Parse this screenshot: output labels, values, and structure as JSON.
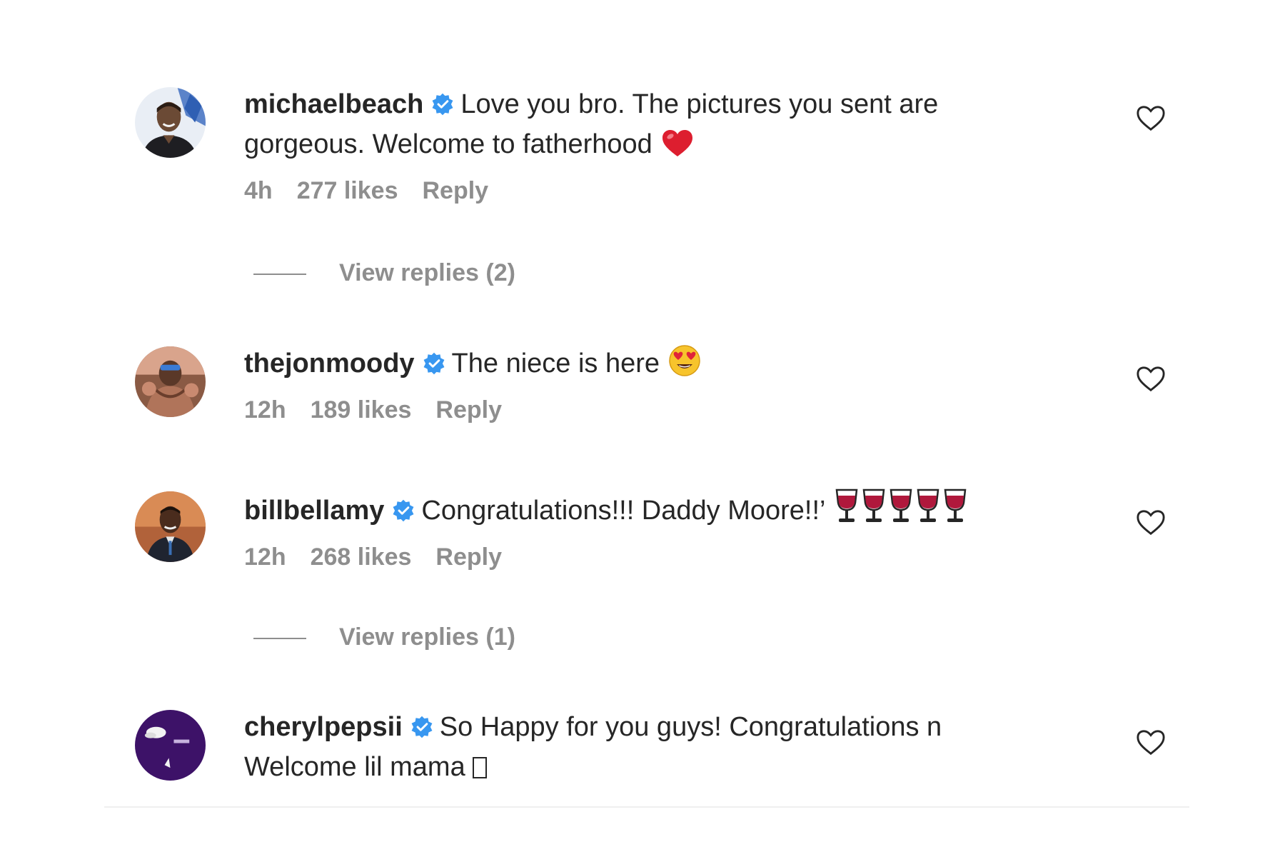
{
  "colors": {
    "username": "#262626",
    "text": "#262626",
    "meta": "#8e8e8e",
    "verified": "#3897f0",
    "divider": "#efefef"
  },
  "comments": [
    {
      "username": "michaelbeach",
      "verified": true,
      "text": "Love you bro. The pictures you sent are gorgeous. Welcome to fatherhood",
      "emoji": "red-heart-icon",
      "time": "4h",
      "likes": "277 likes",
      "reply_label": "Reply",
      "view_replies": "View replies (2)"
    },
    {
      "username": "thejonmoody",
      "verified": true,
      "text": "The niece is here",
      "emoji": "heart-eyes-face-icon",
      "time": "12h",
      "likes": "189 likes",
      "reply_label": "Reply"
    },
    {
      "username": "billbellamy",
      "verified": true,
      "text": "Congratulations!!! Daddy Moore!!’",
      "emoji": "wine-glass-icon",
      "emoji_count": 5,
      "time": "12h",
      "likes": "268 likes",
      "reply_label": "Reply",
      "view_replies": "View replies (1)"
    },
    {
      "username": "cherylpepsii",
      "verified": true,
      "text": "So Happy for you guys! Congratulations n Welcome lil mama",
      "emoji": "missing-glyph-icon"
    }
  ]
}
